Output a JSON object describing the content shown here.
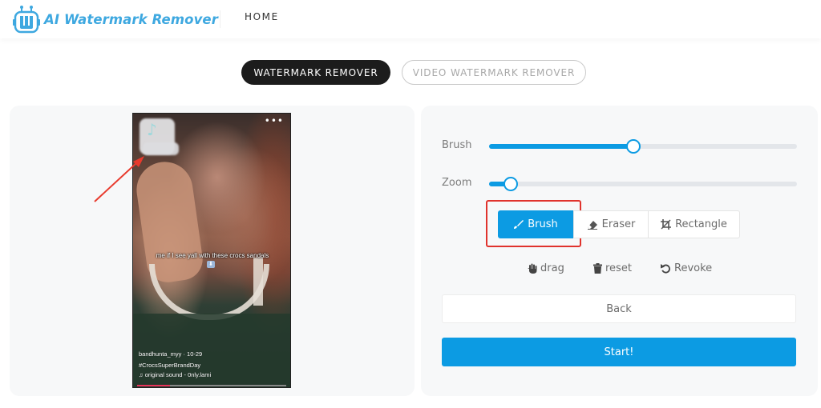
{
  "header": {
    "logo_text": "AI Watermark Remover",
    "logo_icon": "robot-w-icon",
    "nav": [
      {
        "label": "HOME"
      }
    ]
  },
  "mode_tabs": [
    {
      "label": "WATERMARK REMOVER",
      "active": true
    },
    {
      "label": "VIDEO WATERMARK REMOVER",
      "active": false
    }
  ],
  "preview": {
    "more_icon": "•••",
    "watermark_glyph": "♪",
    "caption": "me if I see yall with these crocs sandals",
    "caption_emoji": "⬇",
    "username_line": "bandhunta_myy · 10-29",
    "hashtag": "#CrocsSuperBrandDay",
    "sound_icon": "♫",
    "sound": "original sound - 0nly.lami",
    "playback_progress": 0.22,
    "annotation": "red-arrow-pointing-to-watermark"
  },
  "controls": {
    "brush_slider": {
      "label": "Brush",
      "value": 0.47
    },
    "zoom_slider": {
      "label": "Zoom",
      "value": 0.07
    },
    "tools": [
      {
        "label": "Brush",
        "icon": "brush-icon",
        "active": true,
        "highlighted": true
      },
      {
        "label": "Eraser",
        "icon": "eraser-icon",
        "active": false
      },
      {
        "label": "Rectangle",
        "icon": "crop-icon",
        "active": false
      }
    ],
    "actions": [
      {
        "label": "drag",
        "icon": "hand-icon"
      },
      {
        "label": "reset",
        "icon": "trash-icon"
      },
      {
        "label": "Revoke",
        "icon": "undo-icon"
      }
    ],
    "back_label": "Back",
    "start_label": "Start!"
  },
  "colors": {
    "accent": "#0c9be3",
    "logo": "#3ea8e0",
    "highlight": "#e0332d",
    "tab_active_bg": "#1c1c1c"
  }
}
